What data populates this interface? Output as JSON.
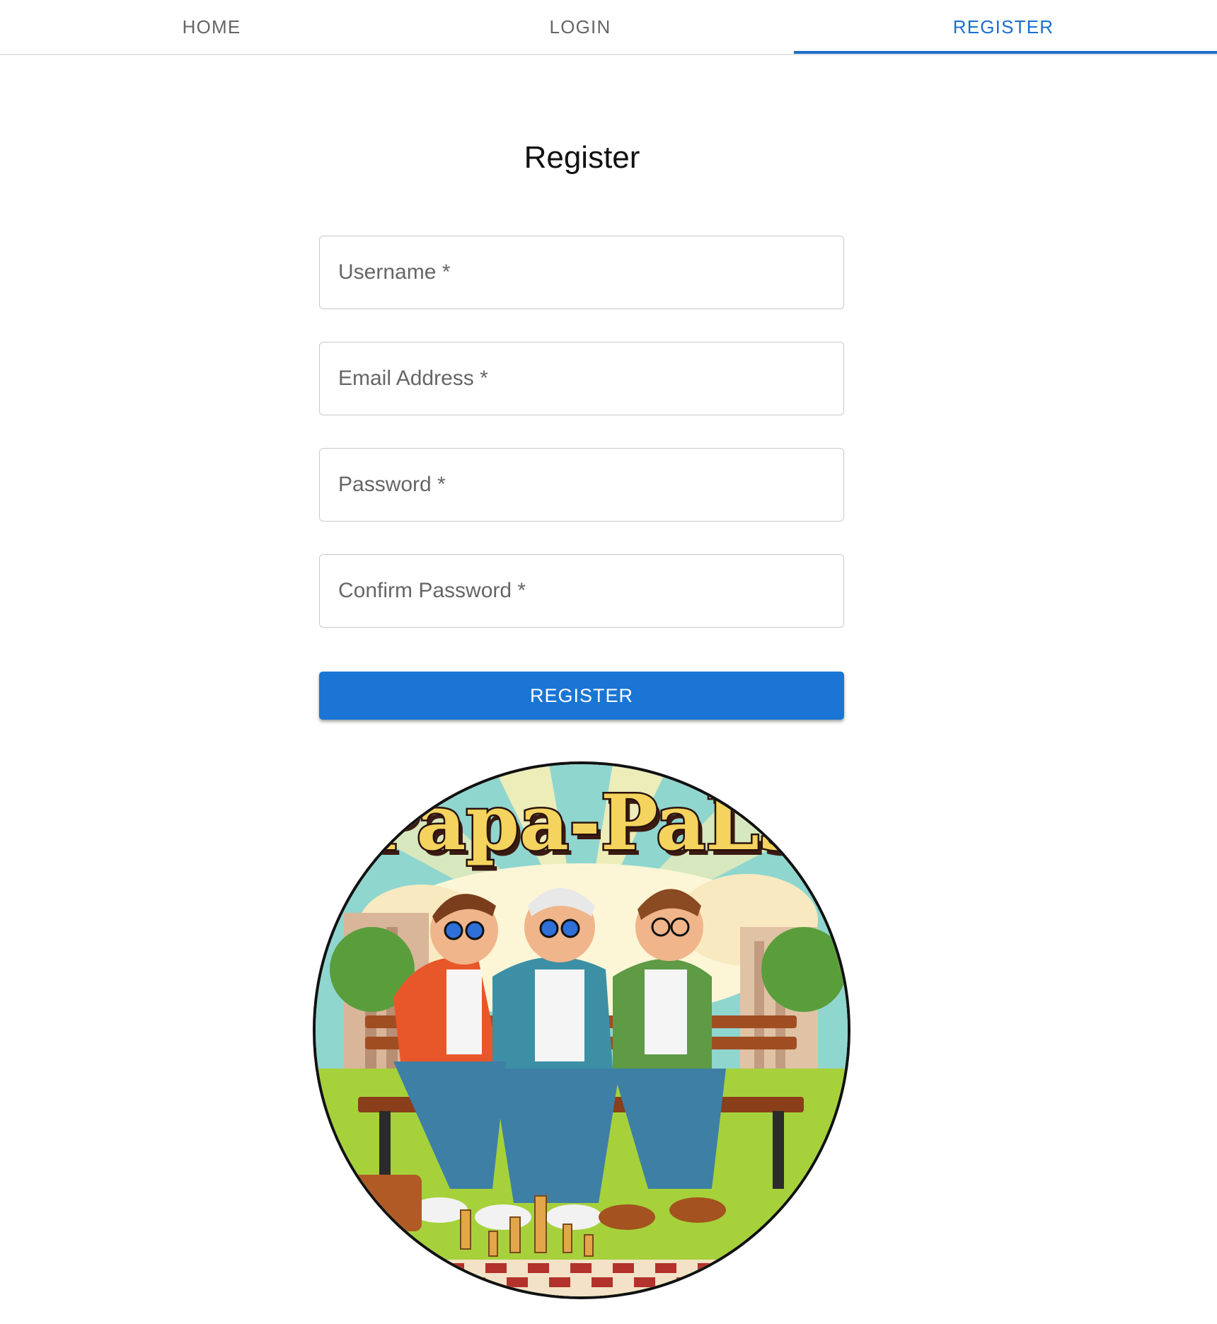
{
  "nav": {
    "tabs": [
      {
        "label": "HOME"
      },
      {
        "label": "LOGIN"
      },
      {
        "label": "REGISTER",
        "active": true
      }
    ],
    "accent_color": "#1f6fc8"
  },
  "form": {
    "title": "Register",
    "fields": {
      "username": {
        "placeholder": "Username *",
        "value": ""
      },
      "email": {
        "placeholder": "Email Address *",
        "value": ""
      },
      "password": {
        "placeholder": "Password *",
        "value": ""
      },
      "confirm_password": {
        "placeholder": "Confirm Password *",
        "value": ""
      }
    },
    "submit_label": "REGISTER",
    "button_color": "#1b75d4"
  },
  "logo": {
    "text": "Papa-PaLs",
    "alt": "Papa-PaLs logo"
  }
}
